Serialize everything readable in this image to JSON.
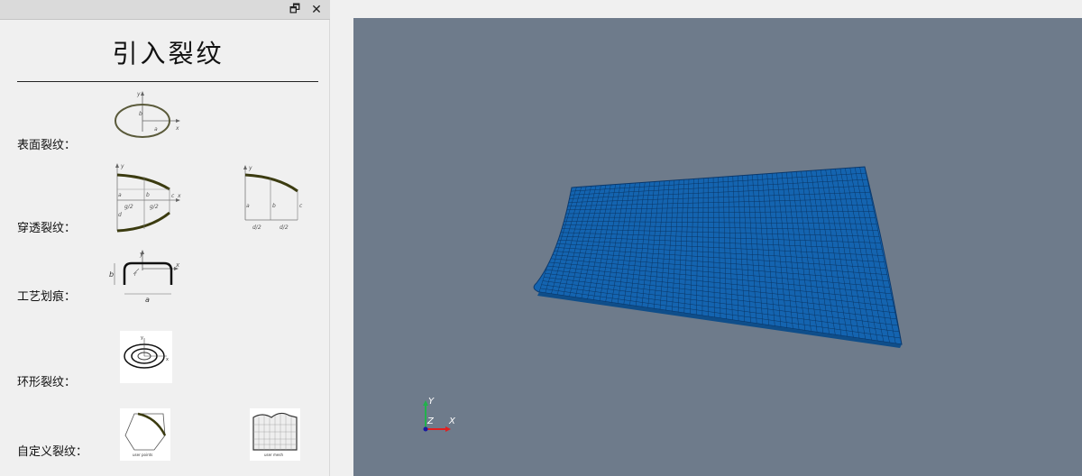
{
  "dock": {
    "float_icon": "restore-window-icon",
    "close_icon": "close-icon",
    "float_glyph": "🗗",
    "close_glyph": "✕",
    "title": "引入裂纹"
  },
  "crack_types": [
    {
      "label": "表面裂纹："
    },
    {
      "label": "穿透裂纹："
    },
    {
      "label": "工艺划痕："
    },
    {
      "label": "环形裂纹："
    },
    {
      "label": "自定义裂纹："
    }
  ],
  "diagram_text": {
    "surface": {
      "y": "y",
      "x": "x",
      "a": "a",
      "b": "b"
    },
    "through_1": {
      "y": "y",
      "x": "x",
      "a": "a",
      "b": "b",
      "c": "c",
      "d": "d",
      "g1": "g/2",
      "g2": "g/2"
    },
    "through_2": {
      "y": "y",
      "x": "x",
      "a": "a",
      "b": "b",
      "c": "c",
      "d1": "d/2",
      "d2": "d/2"
    },
    "scratch": {
      "y": "y",
      "x": "x",
      "a": "a",
      "b": "b",
      "r": "r"
    },
    "ring": {
      "y": "y",
      "x": "x"
    },
    "custom_1": {
      "caption": "user points"
    },
    "custom_2": {
      "caption": "user mesh"
    }
  },
  "viewport": {
    "background": "#6e7b8b",
    "mesh_color": "#1565b0",
    "mesh_line_color": "#0b3563",
    "axes": {
      "y": "Y",
      "z": "Z",
      "x": "X"
    }
  }
}
